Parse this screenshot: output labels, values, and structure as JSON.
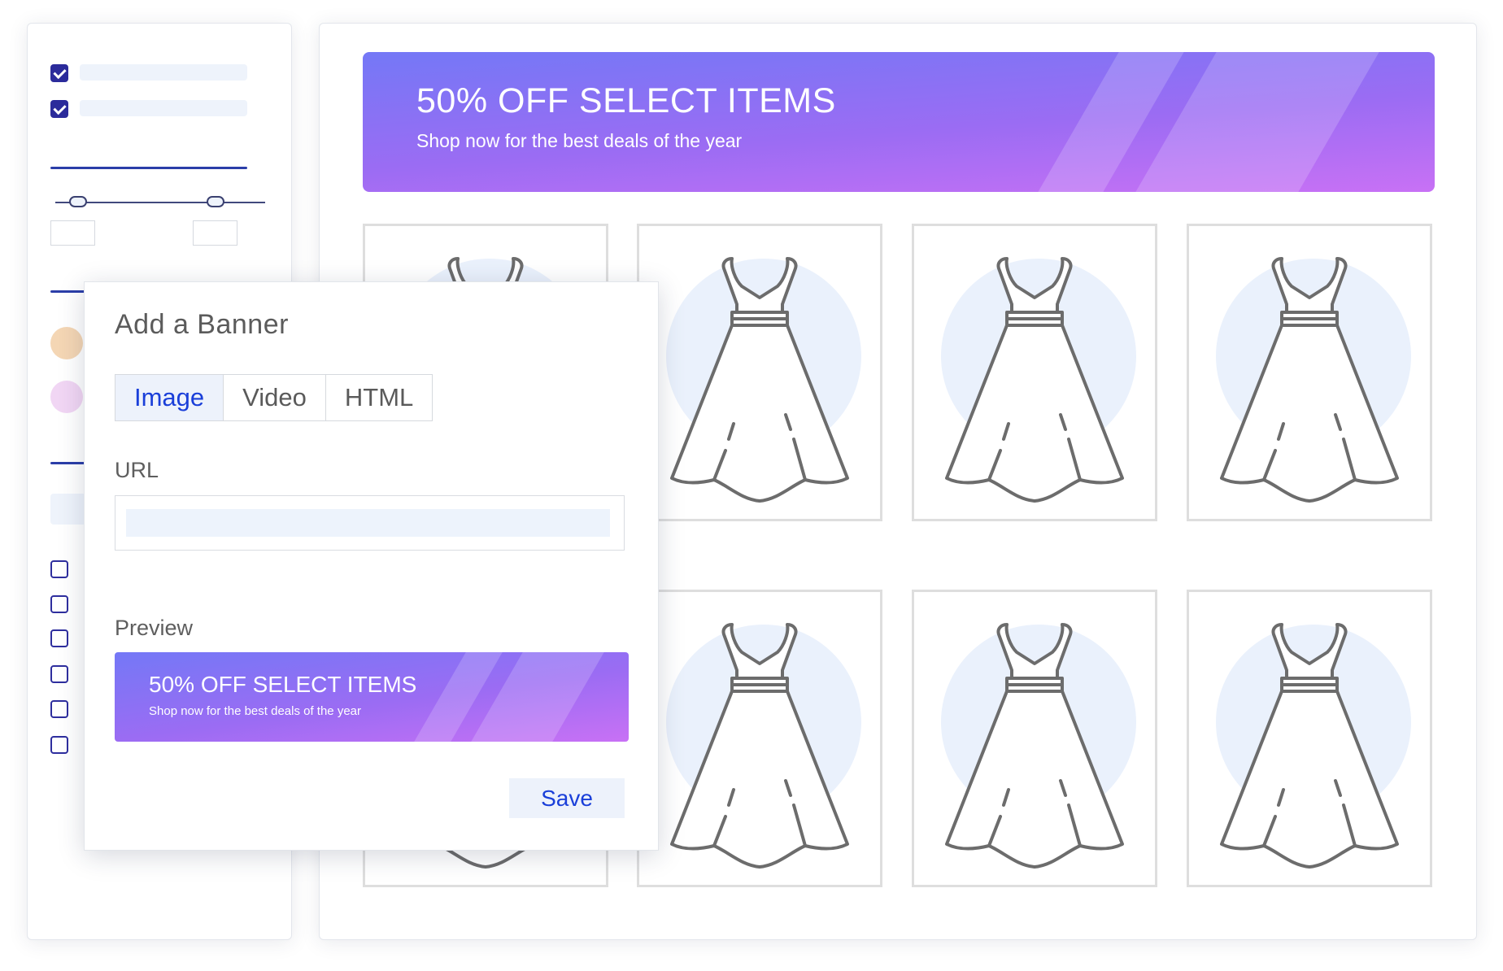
{
  "banner": {
    "title": "50% OFF SELECT ITEMS",
    "subtitle": "Shop now for the best deals of the year"
  },
  "modal": {
    "title": "Add a Banner",
    "tabs": [
      {
        "label": "Image",
        "active": true
      },
      {
        "label": "Video",
        "active": false
      },
      {
        "label": "HTML",
        "active": false
      }
    ],
    "url_label": "URL",
    "url_value": "",
    "preview_label": "Preview",
    "preview": {
      "title": "50% OFF SELECT ITEMS",
      "subtitle": "Shop now for the best deals of the year"
    },
    "save_label": "Save"
  },
  "sidebar": {
    "checked_filters": [
      true,
      true
    ],
    "color_swatches": [
      "#f4d6b4",
      "#f1d6f4"
    ],
    "unchecked_filters": 6
  },
  "products": {
    "icon": "dress-icon",
    "count": 8
  },
  "colors": {
    "accent": "#1a3fd9",
    "banner_start": "#7478f6",
    "banner_end": "#c871f5",
    "checkbox": "#2b2b9b"
  }
}
